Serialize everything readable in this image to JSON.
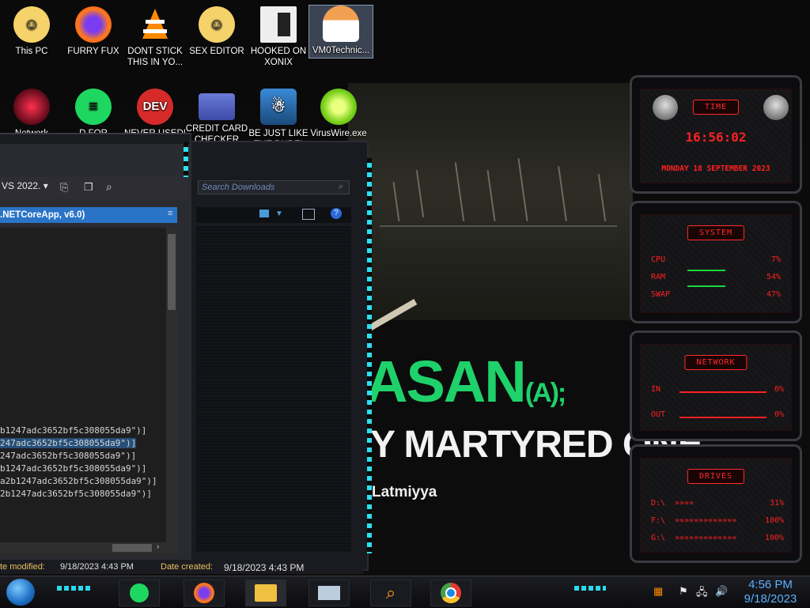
{
  "desktop": {
    "row1": [
      {
        "label": "This PC",
        "icon": "computer-icon"
      },
      {
        "label": "FURRY FUX",
        "icon": "firefox-icon"
      },
      {
        "label": "DONT STICK THIS IN YO...",
        "icon": "vlc-icon"
      },
      {
        "label": "SEX EDITOR",
        "icon": "anime-face-icon"
      },
      {
        "label": "HOOKED ON XONIX",
        "icon": "game-icon"
      },
      {
        "label": "VM0Technic...",
        "icon": "person-icon"
      }
    ],
    "row2": [
      {
        "label": "Network",
        "icon": "network-icon"
      },
      {
        "label": "D FOR",
        "icon": "green-chat-icon"
      },
      {
        "label": "NEVER USED!",
        "icon": "dev-icon",
        "badge": "DEV"
      },
      {
        "label": "CREDIT CARD CHECKER",
        "icon": "credit-card-icon"
      },
      {
        "label": "BE JUST LIKE THE DUDE!",
        "icon": "gnome-icon"
      },
      {
        "label": "VirusWire.exe",
        "icon": "lime-icon"
      }
    ]
  },
  "wallpaper": {
    "title": "ASAN",
    "title_suffix": "(A);",
    "subtitle": "Y MARTYRED ONE",
    "credit": "Latmiyya"
  },
  "explorer": {
    "search_placeholder": "Search Downloads",
    "status_modified_label": "te modified:",
    "status_modified_value": "9/18/2023 4:43 PM",
    "status_created_label": "Date created:",
    "status_created_value": "9/18/2023 4:43 PM"
  },
  "vs": {
    "dropdown": "VS 2022.",
    "tab": ".NETCoreApp, v6.0)",
    "code_lines": [
      "b1247adc3652bf5c308055da9\")]",
      "247adc3652bf5c308055da9\")]",
      "247adc3652bf5c308055da9\")]",
      "b1247adc3652bf5c308055da9\")]",
      "a2b1247adc3652bf5c308055da9\")]",
      "2b1247adc3652bf5c308055da9\")]"
    ]
  },
  "widgets": {
    "time": {
      "title": "TIME",
      "clock": "16:56:02",
      "date": "MONDAY 18 SEPTEMBER 2023"
    },
    "system": {
      "title": "SYSTEM",
      "rows": [
        {
          "label": "CPU",
          "value": "7%"
        },
        {
          "label": "RAM",
          "value": "54%"
        },
        {
          "label": "SWAP",
          "value": "47%"
        }
      ]
    },
    "network": {
      "title": "NETWORK",
      "rows": [
        {
          "label": "IN",
          "value": "0%"
        },
        {
          "label": "OUT",
          "value": "0%"
        }
      ]
    },
    "drives": {
      "title": "DRIVES",
      "rows": [
        {
          "label": "D:\\",
          "value": "31%"
        },
        {
          "label": "F:\\",
          "value": "100%"
        },
        {
          "label": "G:\\",
          "value": "100%"
        }
      ]
    }
  },
  "taskbar": {
    "apps": [
      "green-chat-icon",
      "firefox-icon",
      "file-explorer-icon",
      "network-app-icon",
      "search-icon",
      "chrome-icon"
    ],
    "time": "4:56 PM",
    "date": "9/18/2023"
  }
}
